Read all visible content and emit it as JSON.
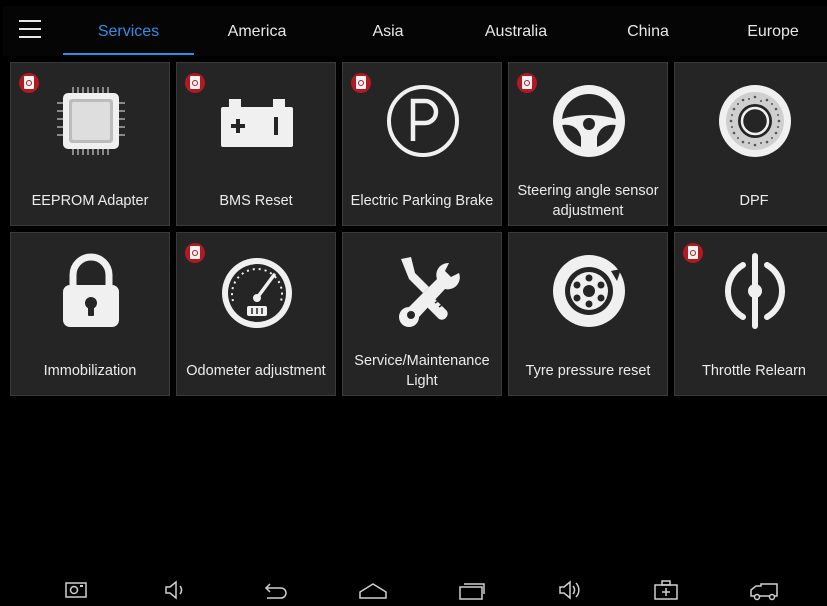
{
  "tabs": [
    {
      "label": "Services",
      "active": true
    },
    {
      "label": "America"
    },
    {
      "label": "Asia"
    },
    {
      "label": "Australia"
    },
    {
      "label": "China"
    },
    {
      "label": "Europe"
    }
  ],
  "tiles": [
    {
      "label": "EEPROM Adapter",
      "icon": "chip-icon",
      "pdf": true
    },
    {
      "label": "BMS Reset",
      "icon": "battery-icon",
      "pdf": true
    },
    {
      "label": "Electric Parking Brake",
      "icon": "parking-brake-icon",
      "pdf": true
    },
    {
      "label": "Steering angle sensor\nadjustment",
      "icon": "steering-wheel-icon",
      "pdf": true
    },
    {
      "label": "DPF",
      "icon": "dpf-filter-icon",
      "pdf": false
    },
    {
      "label": "Immobilization",
      "icon": "padlock-icon",
      "pdf": false
    },
    {
      "label": "Odometer adjustment",
      "icon": "odometer-icon",
      "pdf": true
    },
    {
      "label": "Service/Maintenance\nLight",
      "icon": "wrench-screwdriver-icon",
      "pdf": false
    },
    {
      "label": "Tyre pressure reset",
      "icon": "tyre-icon",
      "pdf": false
    },
    {
      "label": "Throttle Relearn",
      "icon": "throttle-icon",
      "pdf": true
    }
  ],
  "colors": {
    "accent": "#2f8fe8",
    "tile_bg": "#252525",
    "pdf_badge": "#b11a22"
  },
  "navbar": [
    "screenshot-icon",
    "volume-down-icon",
    "back-icon",
    "home-icon",
    "recent-apps-icon",
    "volume-up-icon",
    "toolbox-icon",
    "vci-truck-icon"
  ]
}
